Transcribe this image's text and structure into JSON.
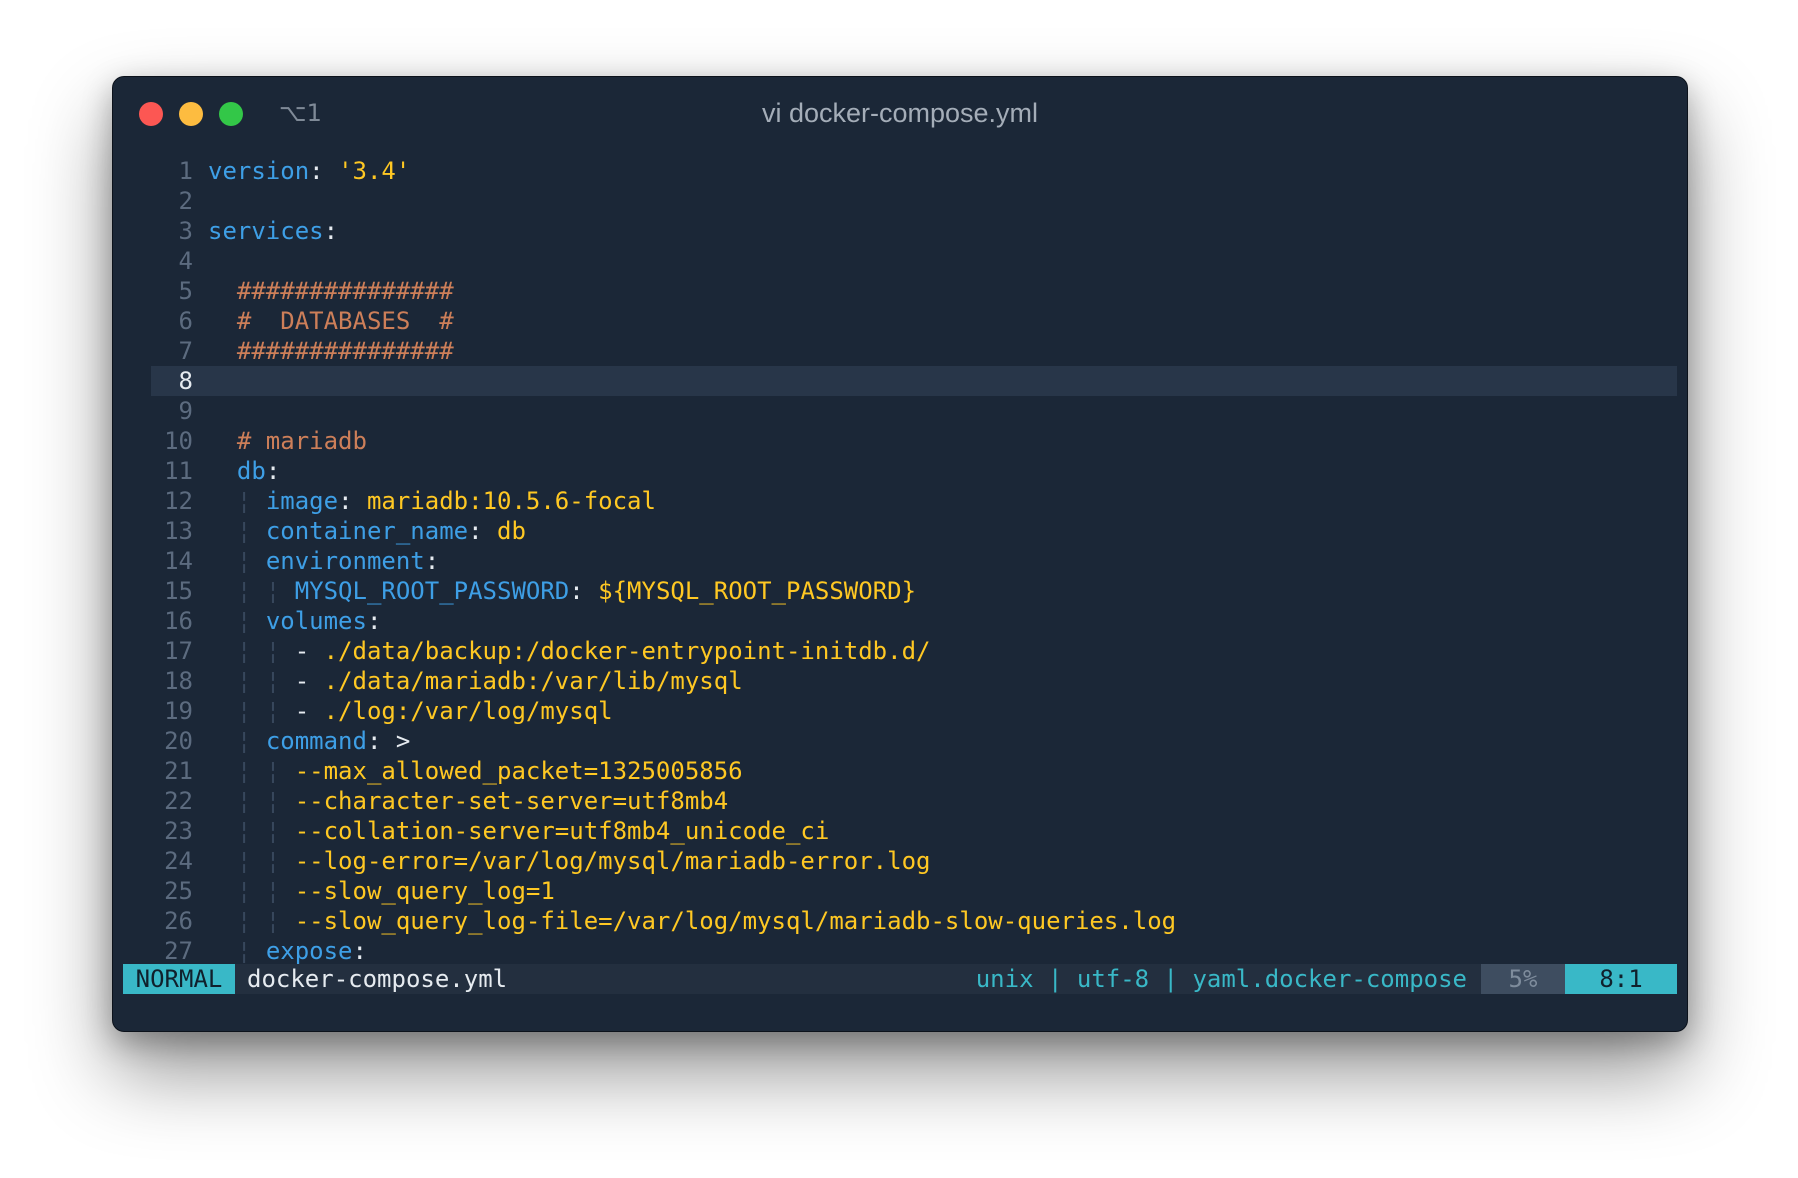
{
  "window": {
    "title": "vi docker-compose.yml",
    "tab_shortcut": "⌥1"
  },
  "editor": {
    "current_line": 8,
    "lines": [
      {
        "n": "1",
        "t": [
          [
            "k",
            "version"
          ],
          [
            "p",
            ": "
          ],
          [
            "s",
            "'3.4'"
          ]
        ]
      },
      {
        "n": "2",
        "t": []
      },
      {
        "n": "3",
        "t": [
          [
            "k",
            "services"
          ],
          [
            "p",
            ":"
          ]
        ]
      },
      {
        "n": "4",
        "t": []
      },
      {
        "n": "5",
        "t": [
          [
            "p",
            "  "
          ],
          [
            "c",
            "###############"
          ]
        ]
      },
      {
        "n": "6",
        "t": [
          [
            "p",
            "  "
          ],
          [
            "c",
            "#  DATABASES  #"
          ]
        ]
      },
      {
        "n": "7",
        "t": [
          [
            "p",
            "  "
          ],
          [
            "c",
            "###############"
          ]
        ]
      },
      {
        "n": "8",
        "t": []
      },
      {
        "n": "9",
        "t": []
      },
      {
        "n": "10",
        "t": [
          [
            "p",
            "  "
          ],
          [
            "c",
            "# mariadb"
          ]
        ]
      },
      {
        "n": "11",
        "t": [
          [
            "p",
            "  "
          ],
          [
            "k",
            "db"
          ],
          [
            "p",
            ":"
          ]
        ]
      },
      {
        "n": "12",
        "t": [
          [
            "p",
            "  "
          ],
          [
            "g",
            "¦ "
          ],
          [
            "k",
            "image"
          ],
          [
            "p",
            ": "
          ],
          [
            "s",
            "mariadb:10.5.6-focal"
          ]
        ]
      },
      {
        "n": "13",
        "t": [
          [
            "p",
            "  "
          ],
          [
            "g",
            "¦ "
          ],
          [
            "k",
            "container_name"
          ],
          [
            "p",
            ": "
          ],
          [
            "s",
            "db"
          ]
        ]
      },
      {
        "n": "14",
        "t": [
          [
            "p",
            "  "
          ],
          [
            "g",
            "¦ "
          ],
          [
            "k",
            "environment"
          ],
          [
            "p",
            ":"
          ]
        ]
      },
      {
        "n": "15",
        "t": [
          [
            "p",
            "  "
          ],
          [
            "g",
            "¦ ¦ "
          ],
          [
            "k",
            "MYSQL_ROOT_PASSWORD"
          ],
          [
            "p",
            ": "
          ],
          [
            "s",
            "${MYSQL_ROOT_PASSWORD}"
          ]
        ]
      },
      {
        "n": "16",
        "t": [
          [
            "p",
            "  "
          ],
          [
            "g",
            "¦ "
          ],
          [
            "k",
            "volumes"
          ],
          [
            "p",
            ":"
          ]
        ]
      },
      {
        "n": "17",
        "t": [
          [
            "p",
            "  "
          ],
          [
            "g",
            "¦ ¦ "
          ],
          [
            "p",
            "- "
          ],
          [
            "s",
            "./data/backup:/docker-entrypoint-initdb.d/"
          ]
        ]
      },
      {
        "n": "18",
        "t": [
          [
            "p",
            "  "
          ],
          [
            "g",
            "¦ ¦ "
          ],
          [
            "p",
            "- "
          ],
          [
            "s",
            "./data/mariadb:/var/lib/mysql"
          ]
        ]
      },
      {
        "n": "19",
        "t": [
          [
            "p",
            "  "
          ],
          [
            "g",
            "¦ ¦ "
          ],
          [
            "p",
            "- "
          ],
          [
            "s",
            "./log:/var/log/mysql"
          ]
        ]
      },
      {
        "n": "20",
        "t": [
          [
            "p",
            "  "
          ],
          [
            "g",
            "¦ "
          ],
          [
            "k",
            "command"
          ],
          [
            "p",
            ": >"
          ]
        ]
      },
      {
        "n": "21",
        "t": [
          [
            "p",
            "  "
          ],
          [
            "g",
            "¦ ¦ "
          ],
          [
            "s",
            "--max_allowed_packet=1325005856"
          ]
        ]
      },
      {
        "n": "22",
        "t": [
          [
            "p",
            "  "
          ],
          [
            "g",
            "¦ ¦ "
          ],
          [
            "s",
            "--character-set-server=utf8mb4"
          ]
        ]
      },
      {
        "n": "23",
        "t": [
          [
            "p",
            "  "
          ],
          [
            "g",
            "¦ ¦ "
          ],
          [
            "s",
            "--collation-server=utf8mb4_unicode_ci"
          ]
        ]
      },
      {
        "n": "24",
        "t": [
          [
            "p",
            "  "
          ],
          [
            "g",
            "¦ ¦ "
          ],
          [
            "s",
            "--log-error=/var/log/mysql/mariadb-error.log"
          ]
        ]
      },
      {
        "n": "25",
        "t": [
          [
            "p",
            "  "
          ],
          [
            "g",
            "¦ ¦ "
          ],
          [
            "s",
            "--slow_query_log=1"
          ]
        ]
      },
      {
        "n": "26",
        "t": [
          [
            "p",
            "  "
          ],
          [
            "g",
            "¦ ¦ "
          ],
          [
            "s",
            "--slow_query_log-file=/var/log/mysql/mariadb-slow-queries.log"
          ]
        ]
      },
      {
        "n": "27",
        "t": [
          [
            "p",
            "  "
          ],
          [
            "g",
            "¦ "
          ],
          [
            "k",
            "expose"
          ],
          [
            "p",
            ":"
          ]
        ]
      }
    ]
  },
  "statusline": {
    "mode": "NORMAL",
    "filename": "docker-compose.yml",
    "fileinfo": "unix | utf-8 | yaml.docker-compose",
    "percent": "5%",
    "position": "8:1"
  },
  "colors": {
    "background": "#1b2737",
    "key": "#3e9fe6",
    "string": "#ffc823",
    "comment": "#cd7f59",
    "accent": "#39b8c7"
  }
}
